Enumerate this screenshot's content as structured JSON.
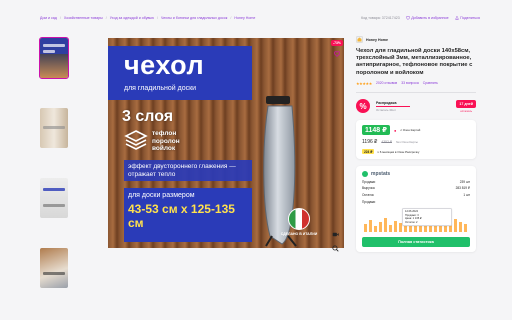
{
  "breadcrumbs": [
    "Дом и сад",
    "Хозяйственные товары",
    "Уход за одеждой и обувью",
    "Чехлы и ботинки для гладильных досок",
    "Honey Home"
  ],
  "header_actions": {
    "article": "Код товара: 372417423",
    "favorite": "Добавить в избранное",
    "share": "Поделиться"
  },
  "hero": {
    "title": "чехол",
    "subtitle": "для гладильной доски",
    "layers_title": "3 слоя",
    "layers": [
      "тефлон",
      "поролон",
      "войлок"
    ],
    "effect": "эффект двустороннего глажения — отражает тепло",
    "size_intro": "для доски размером",
    "size_value": "43-53 см х 125-135 см",
    "flag_caption": "Сделано в Италии"
  },
  "discount_badge": "-73%",
  "product": {
    "brand": "Honey Home",
    "title": "Чехол для гладильной доски 140x58см, трехслойный 3мм, металлизированное, антипригарное, тефлоновое покрытие с поролоном и войлоком",
    "rating_stars": "★★★★★",
    "reviews": "2020 отзывов",
    "questions": "33 вопроса",
    "compare": "Сравнить"
  },
  "sale": {
    "label": "Распродажа",
    "sublabel": "Осталось 30шт",
    "days": "17 дней",
    "days_sub": "осталось"
  },
  "price": {
    "now": "1148 ₽",
    "wallet": "с Озон Картой",
    "card_price": "1196 ₽",
    "old": "4352 ₽",
    "wallet2": "без Озон Карты",
    "installment_amount": "224 ₽",
    "installment_text": "х 6 месяцев в Озон Рассрочку"
  },
  "stats": {
    "name": "mpstats",
    "rows": [
      {
        "k": "Продажи",
        "v": "239 шт"
      },
      {
        "k": "Выручка",
        "v": "283 819 ₽"
      },
      {
        "k": "Остаток",
        "v": "1 шт"
      }
    ],
    "chart_label": "Продажи",
    "tooltip_date": "12.06.2024",
    "tooltip_lines": [
      "Продажи: 3",
      "Цена: 1 135 ₽",
      "Остаток: 2"
    ],
    "button": "Полная статистика",
    "accent": "#20c06a"
  },
  "colors": {
    "brand": "#cb11ab",
    "link": "#8b3bd8",
    "sale": "#f91155",
    "price": "#22bb55",
    "hero_blue": "#2a3bb8"
  }
}
